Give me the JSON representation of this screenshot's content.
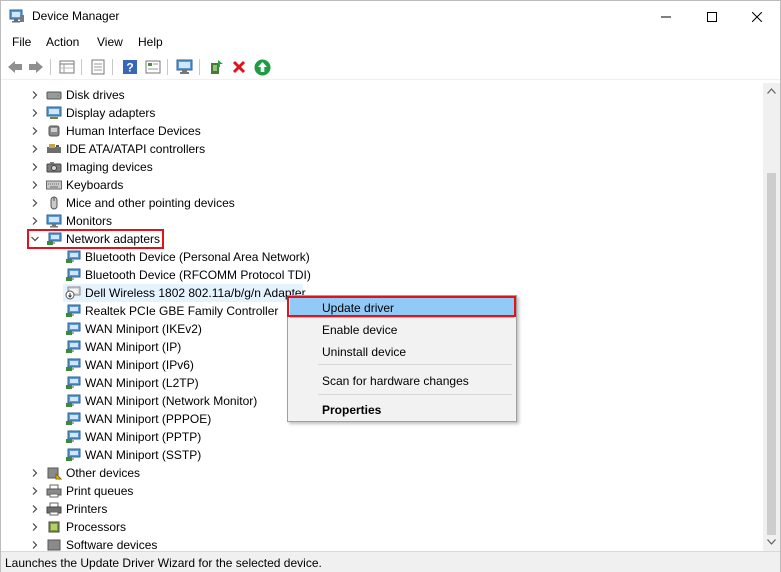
{
  "window": {
    "title": "Device Manager",
    "controls": {
      "minimize": "minimize",
      "maximize": "maximize",
      "close": "close"
    }
  },
  "menu": [
    "File",
    "Action",
    "View",
    "Help"
  ],
  "toolbar": {
    "buttons": [
      "back-icon",
      "forward-icon",
      "properties-grid-icon",
      "details-icon",
      "help-icon",
      "view-icon",
      "monitor-icon",
      "update-driver-icon",
      "uninstall-icon",
      "scan-icon"
    ]
  },
  "tree": {
    "categories_top": [
      {
        "label": "Disk drives",
        "icon": "disk-icon"
      },
      {
        "label": "Display adapters",
        "icon": "display-icon"
      },
      {
        "label": "Human Interface Devices",
        "icon": "hid-icon"
      },
      {
        "label": "IDE ATA/ATAPI controllers",
        "icon": "ide-icon"
      },
      {
        "label": "Imaging devices",
        "icon": "camera-icon"
      },
      {
        "label": "Keyboards",
        "icon": "keyboard-icon"
      },
      {
        "label": "Mice and other pointing devices",
        "icon": "mouse-icon"
      },
      {
        "label": "Monitors",
        "icon": "monitor-icon"
      },
      {
        "label": "Network adapters",
        "icon": "network-icon"
      }
    ],
    "network_children": [
      "Bluetooth Device (Personal Area Network)",
      "Bluetooth Device (RFCOMM Protocol TDI)",
      "Dell Wireless 1802 802.11a/b/g/n Adapter",
      "Realtek PCIe GBE Family Controller",
      "WAN Miniport (IKEv2)",
      "WAN Miniport (IP)",
      "WAN Miniport (IPv6)",
      "WAN Miniport (L2TP)",
      "WAN Miniport (Network Monitor)",
      "WAN Miniport (PPPOE)",
      "WAN Miniport (PPTP)",
      "WAN Miniport (SSTP)"
    ],
    "categories_bottom": [
      {
        "label": "Other devices",
        "icon": "other-device-icon"
      },
      {
        "label": "Print queues",
        "icon": "printer-queue-icon"
      },
      {
        "label": "Printers",
        "icon": "printer-icon"
      },
      {
        "label": "Processors",
        "icon": "processor-icon"
      },
      {
        "label": "Software devices",
        "icon": "software-icon"
      }
    ]
  },
  "context_menu": {
    "items": [
      "Update driver",
      "Enable device",
      "Uninstall device",
      "Scan for hardware changes",
      "Properties"
    ]
  },
  "status": "Launches the Update Driver Wizard for the selected device.",
  "colors": {
    "highlight": "#91c9f7",
    "selection": "#e5f3ff",
    "annotation_red": "#e0121a",
    "green_scan": "#1a9e3f",
    "red_uninstall": "#e0121a"
  }
}
